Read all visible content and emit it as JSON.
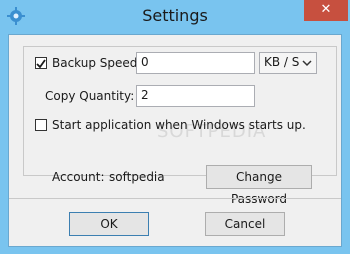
{
  "window": {
    "title": "Settings",
    "close_glyph": "✕",
    "app_icon": "gear-icon"
  },
  "backup_speed": {
    "label": "Backup Speed:",
    "checked": true,
    "value": "0",
    "unit": "KB / S",
    "unit_arrow": "chevron-down-icon"
  },
  "copy_quantity": {
    "label": "Copy Quantity:",
    "value": "2"
  },
  "start_with_windows": {
    "label": "Start application when Windows starts up.",
    "checked": false
  },
  "account": {
    "label": "Account:",
    "value": "softpedia",
    "change_password": "Change Password"
  },
  "buttons": {
    "ok": "OK",
    "cancel": "Cancel"
  },
  "watermark": "SOFTPEDIA"
}
